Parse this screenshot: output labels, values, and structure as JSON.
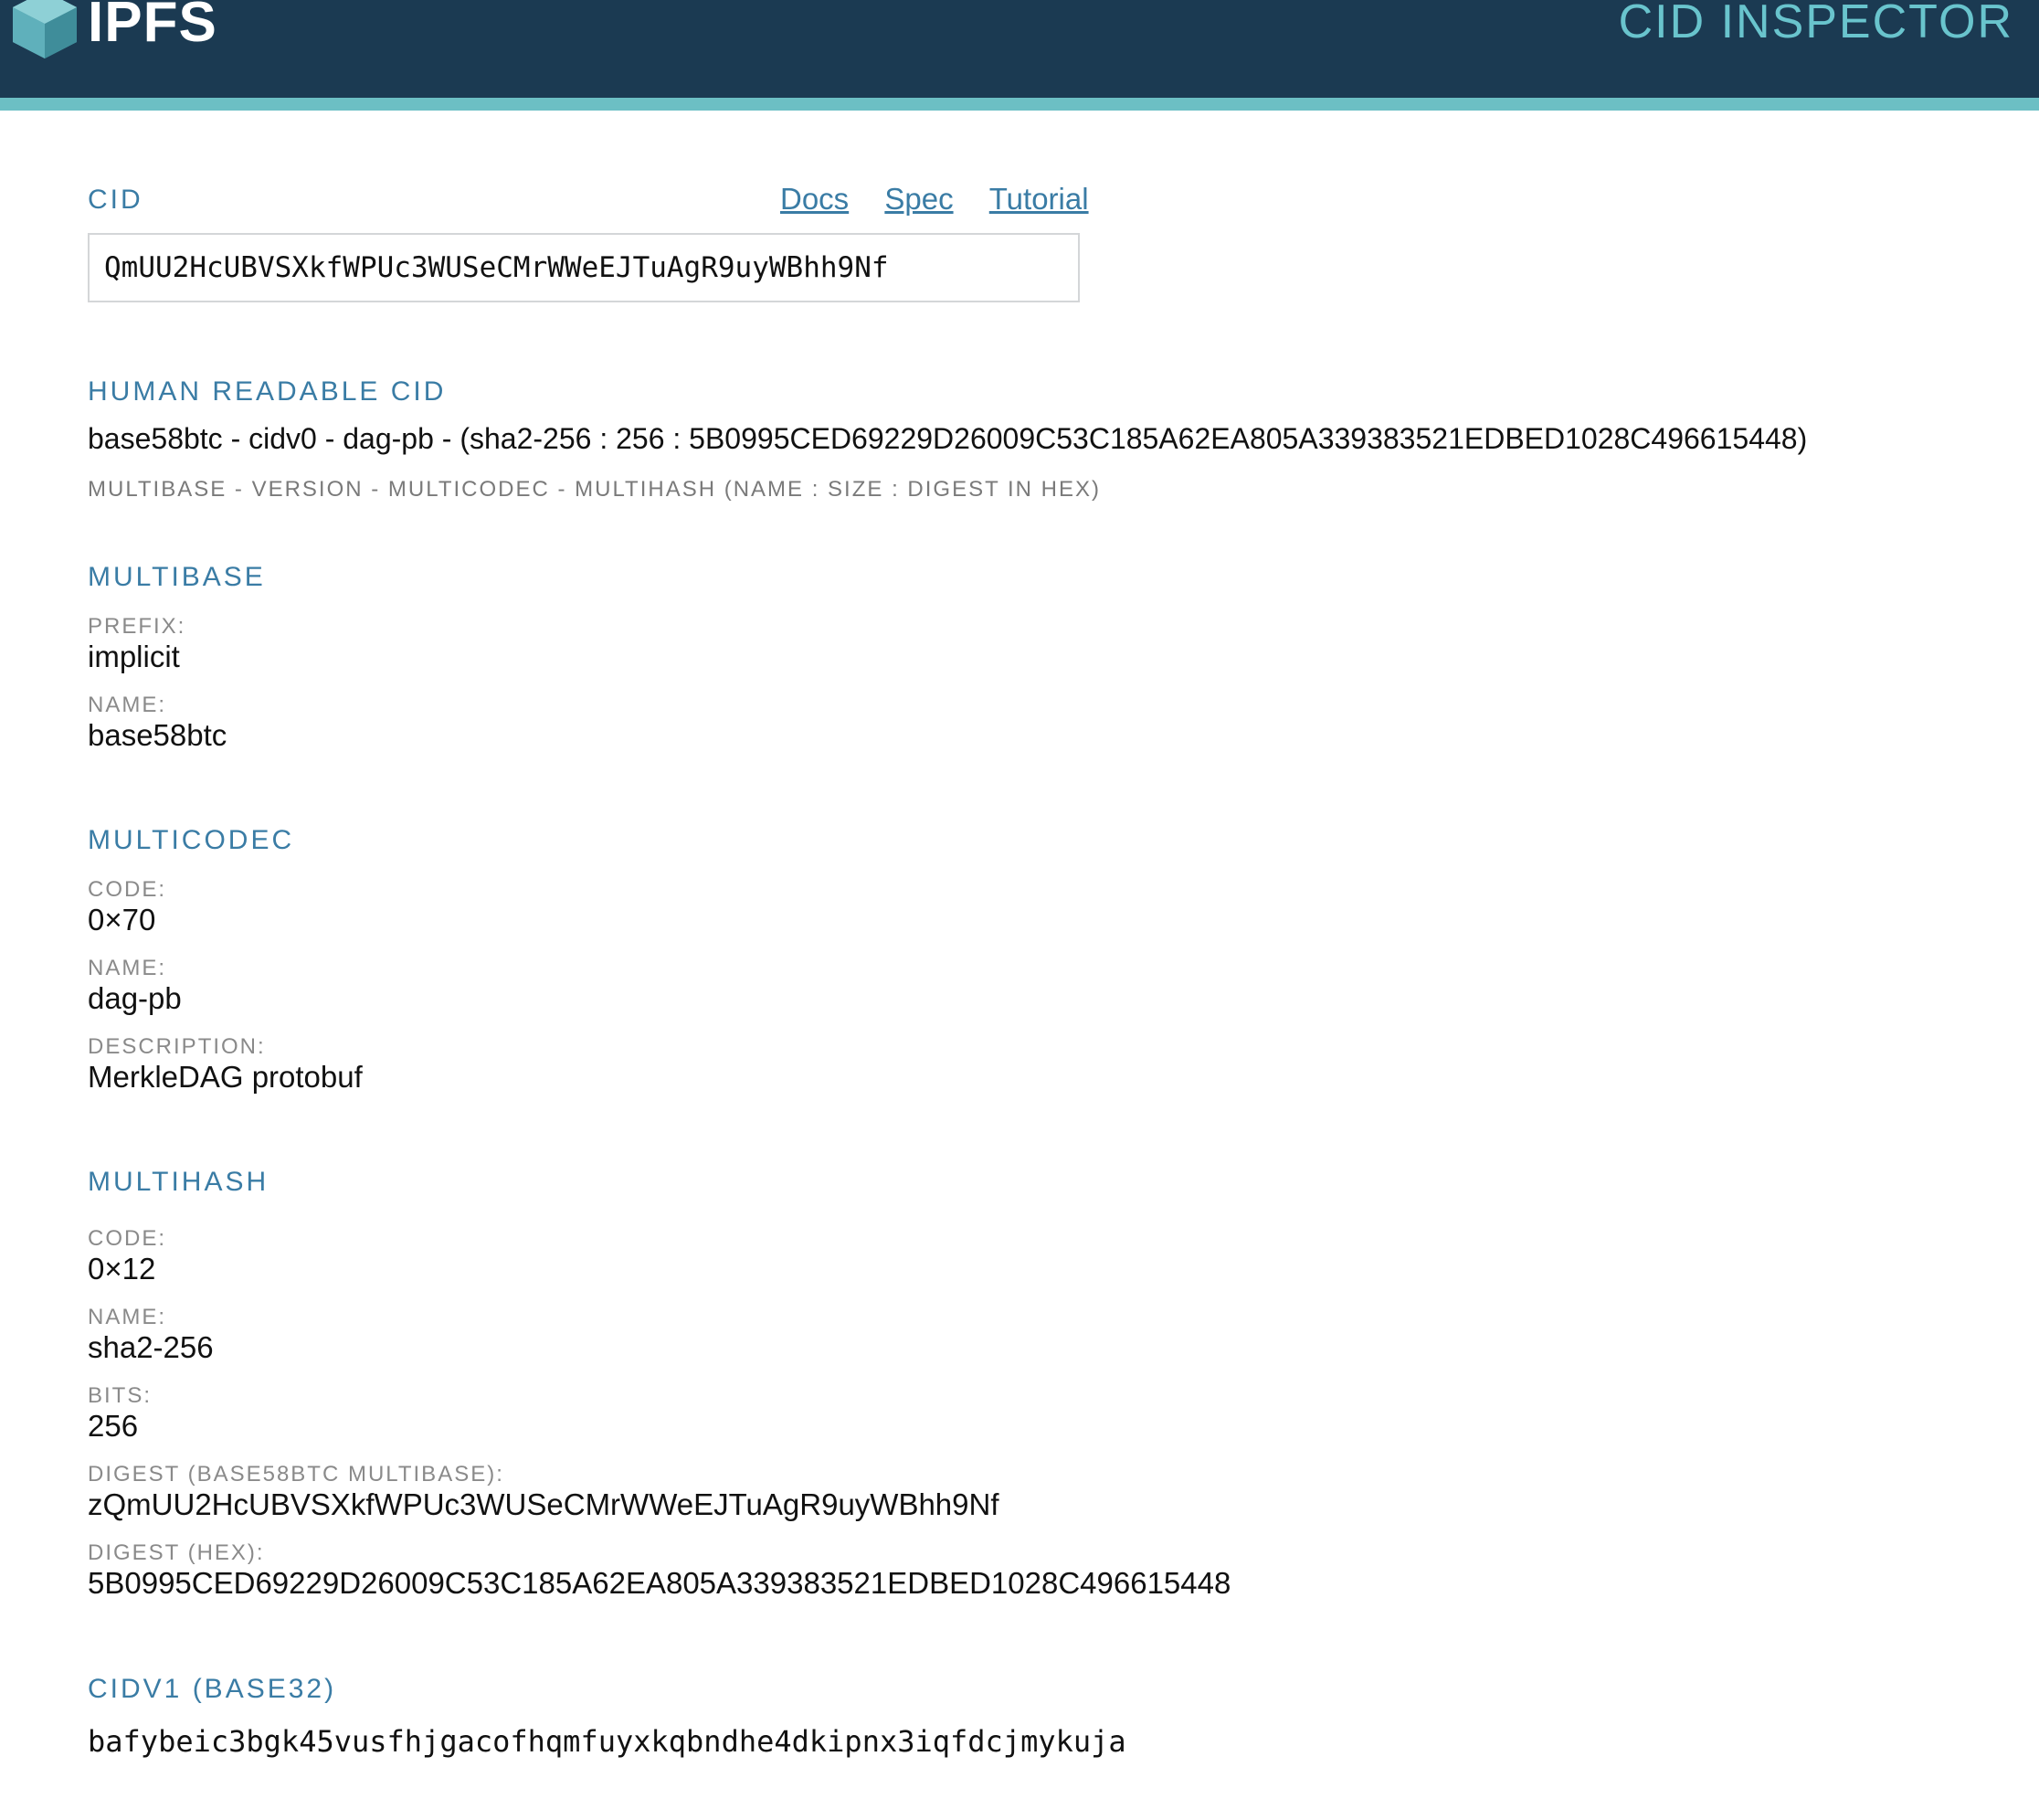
{
  "header": {
    "logo_text": "IPFS",
    "app_title": "CID INSPECTOR"
  },
  "cid_section": {
    "title": "CID",
    "links": [
      "Docs",
      "Spec",
      "Tutorial"
    ],
    "input_value": "QmUU2HcUBVSXkfWPUc3WUSeCMrWWeEJTuAgR9uyWBhh9Nf"
  },
  "human_readable": {
    "title": "HUMAN READABLE CID",
    "value": "base58btc - cidv0 - dag-pb - (sha2-256 : 256 : 5B0995CED69229D26009C53C185A62EA805A339383521EDBED1028C496615448)",
    "caption": "MULTIBASE - VERSION - MULTICODEC - MULTIHASH (NAME : SIZE : DIGEST IN HEX)"
  },
  "multibase": {
    "title": "MULTIBASE",
    "prefix_label": "PREFIX:",
    "prefix": "implicit",
    "name_label": "NAME:",
    "name": "base58btc"
  },
  "multicodec": {
    "title": "MULTICODEC",
    "code_label": "CODE:",
    "code": "0×70",
    "name_label": "NAME:",
    "name": "dag-pb",
    "description_label": "DESCRIPTION:",
    "description": "MerkleDAG protobuf"
  },
  "multihash": {
    "title": "MULTIHASH",
    "code_label": "CODE:",
    "code": "0×12",
    "name_label": "NAME:",
    "name": "sha2-256",
    "bits_label": "BITS:",
    "bits": "256",
    "digest_b58_label": "DIGEST (BASE58BTC MULTIBASE):",
    "digest_b58": "zQmUU2HcUBVSXkfWPUc3WUSeCMrWWeEJTuAgR9uyWBhh9Nf",
    "digest_hex_label": "DIGEST (HEX):",
    "digest_hex": "5B0995CED69229D26009C53C185A62EA805A339383521EDBED1028C496615448"
  },
  "cidv1": {
    "title": "CIDV1 (BASE32)",
    "value": "bafybeic3bgk45vusfhjgacofhqmfuyxkqbndhe4dkipnx3iqfdcjmykuja"
  }
}
